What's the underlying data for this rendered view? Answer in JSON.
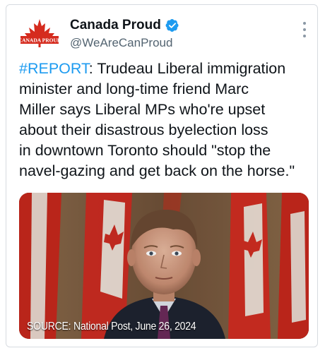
{
  "tweet": {
    "display_name": "Canada Proud",
    "handle": "@WeAreCanProud",
    "avatar_text": "CANADA PROUD",
    "hashtag": "#REPORT",
    "body_lines": [
      ": Trudeau Liberal immigration",
      "minister and long-time friend Marc",
      "Miller says Liberal MPs who're upset",
      "about their disastrous byelection loss",
      "in downtown Toronto should \"stop the",
      "navel-gazing and get back on the horse.\""
    ],
    "image_caption": "SOURCE: National Post, June 26, 2024"
  },
  "colors": {
    "link": "#1d9bf0",
    "verified": "#1d9bf0",
    "canada_red": "#d52b1e",
    "text": "#0f1419",
    "secondary": "#536471"
  },
  "icons": {
    "verified": "verified-badge-icon",
    "more": "more-options-icon",
    "avatar": "maple-leaf-logo"
  }
}
